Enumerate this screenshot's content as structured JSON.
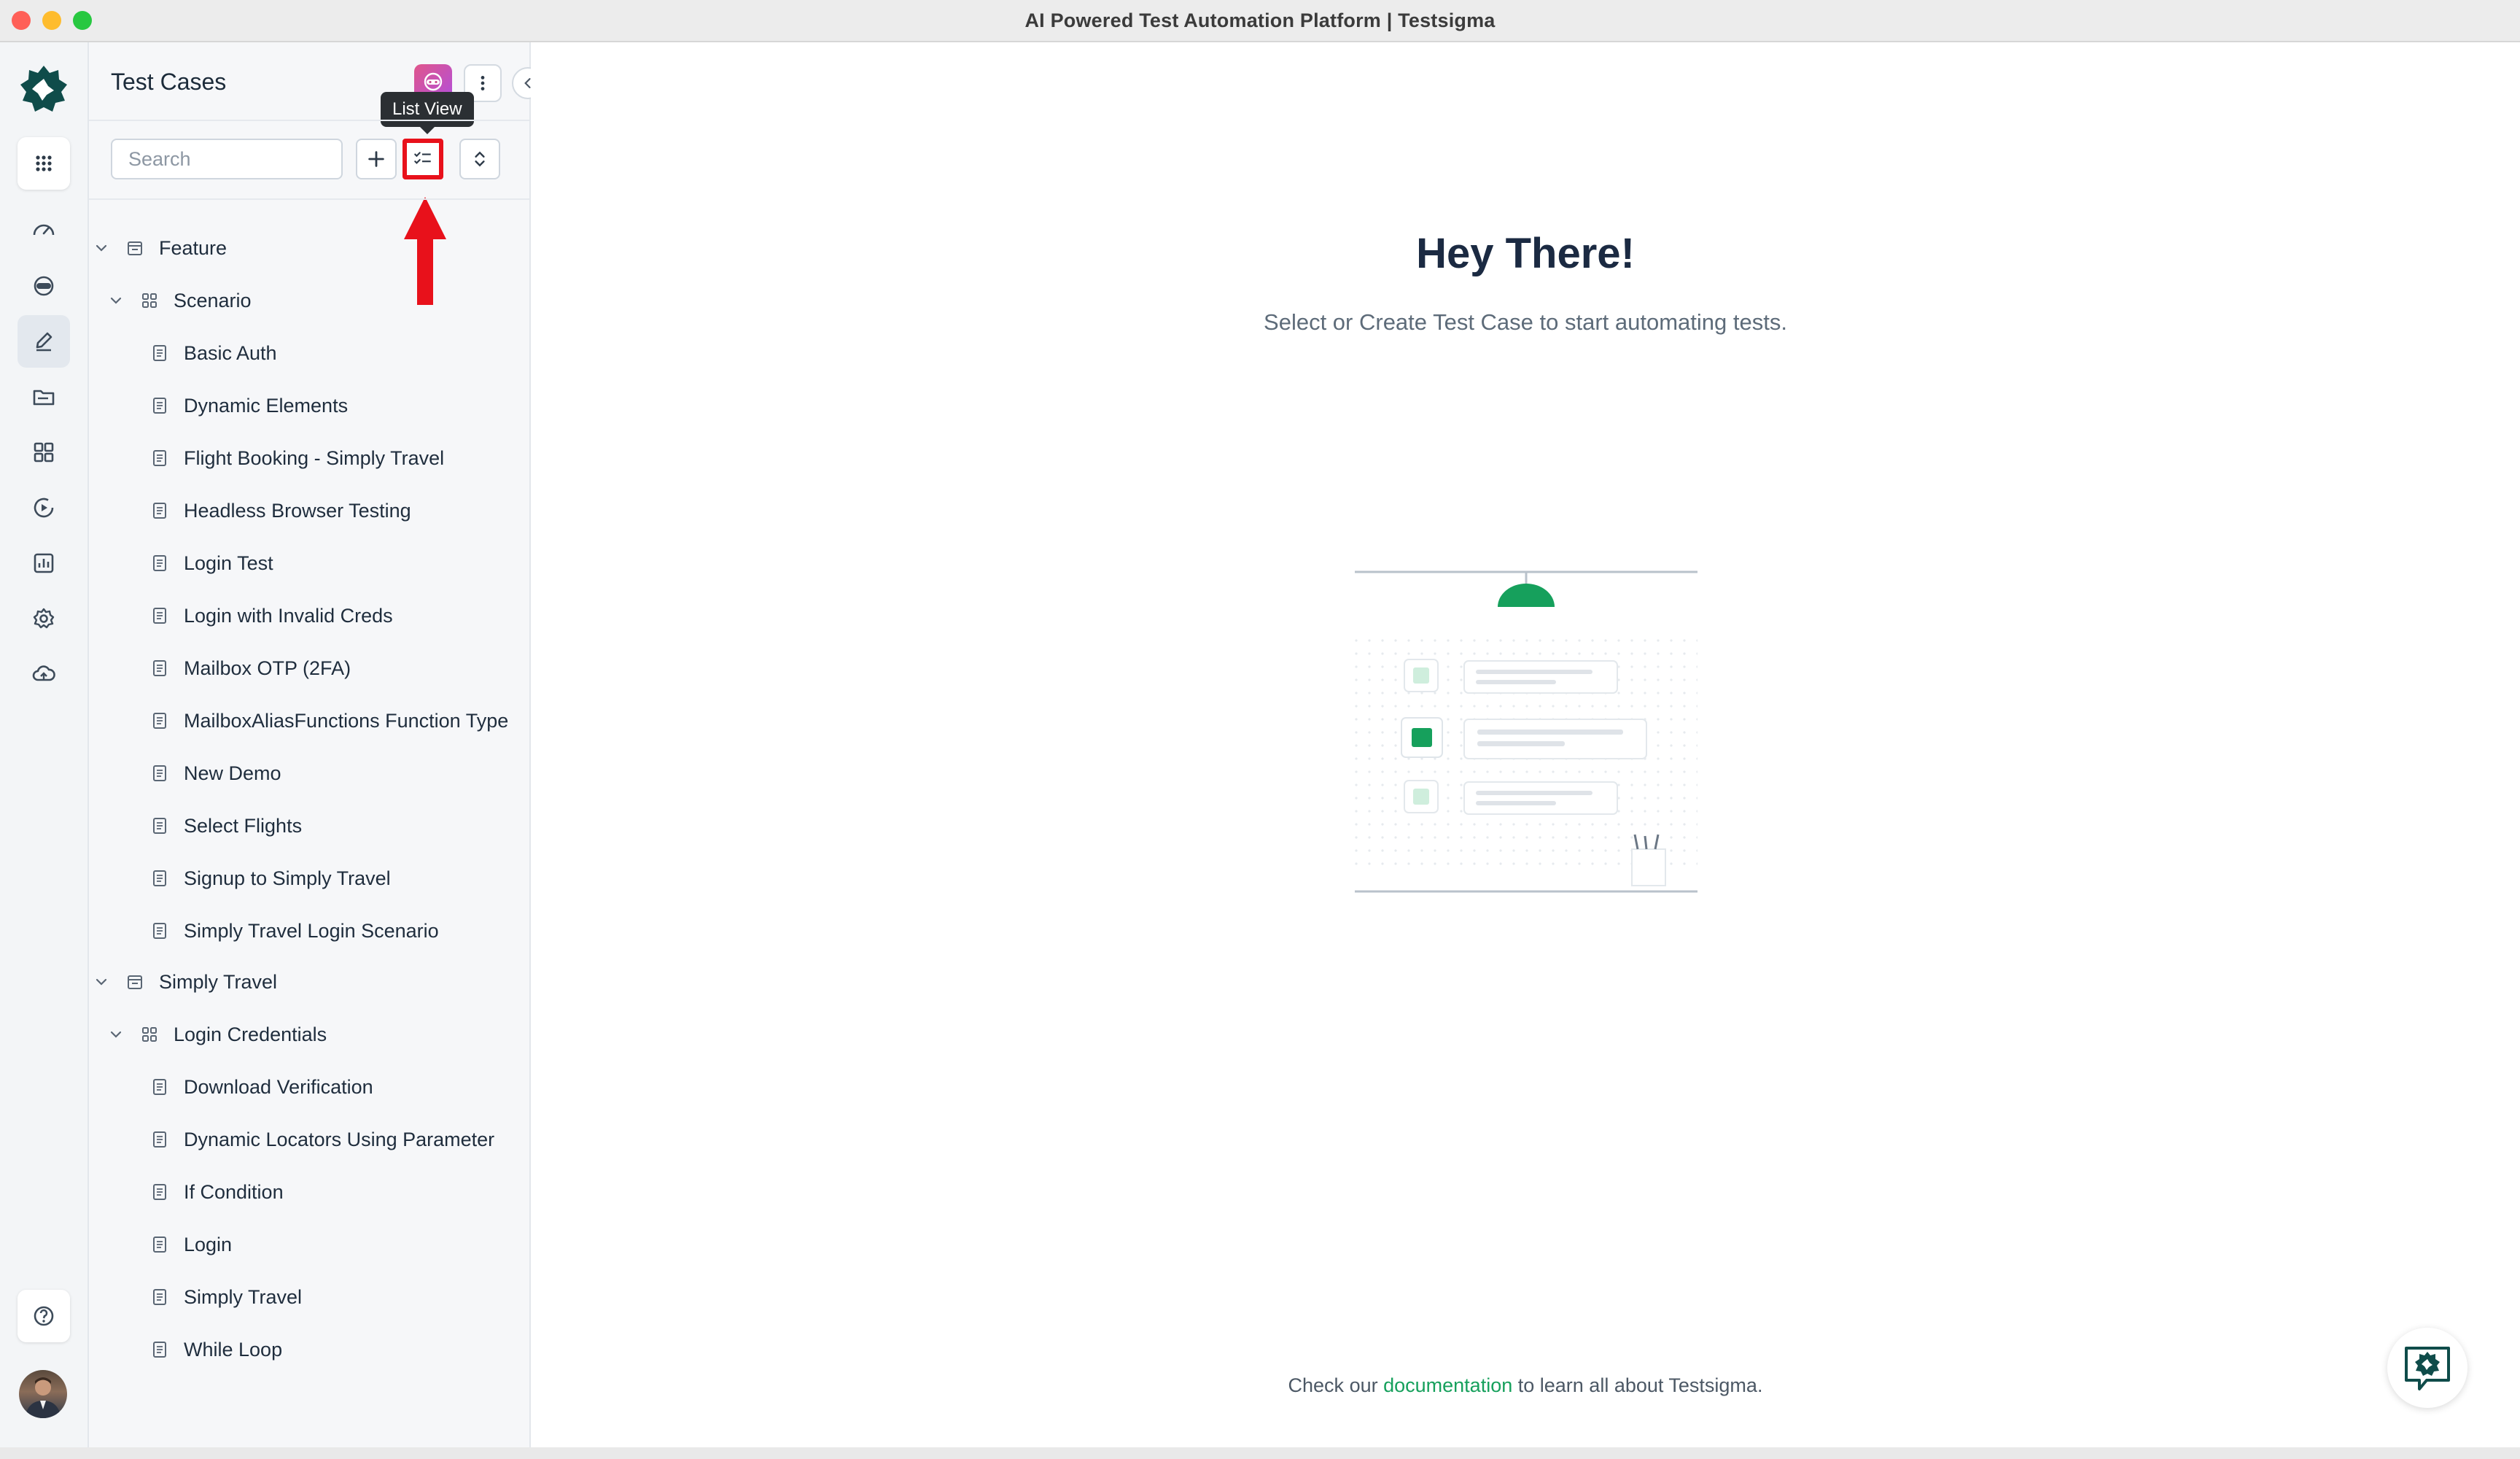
{
  "window": {
    "title": "AI Powered Test Automation Platform | Testsigma"
  },
  "nav": {
    "items": [
      {
        "icon": "apps-grid-icon"
      },
      {
        "icon": "dashboard-icon"
      },
      {
        "icon": "ai-agent-icon"
      },
      {
        "icon": "edit-test-icon"
      },
      {
        "icon": "folder-icon"
      },
      {
        "icon": "modules-icon"
      },
      {
        "icon": "run-icon"
      },
      {
        "icon": "reports-icon"
      },
      {
        "icon": "settings-icon"
      },
      {
        "icon": "cloud-icon"
      },
      {
        "icon": "help-icon"
      }
    ]
  },
  "panel": {
    "title": "Test Cases",
    "search_placeholder": "Search",
    "tooltip": "List View"
  },
  "tree": {
    "groups": [
      {
        "feature": "Feature",
        "scenario": "Scenario",
        "cases": [
          "Basic Auth",
          "Dynamic Elements",
          "Flight Booking - Simply Travel",
          "Headless Browser Testing",
          "Login Test",
          "Login with Invalid Creds",
          "Mailbox OTP (2FA)",
          "MailboxAliasFunctions Function Type",
          "New Demo",
          "Select Flights",
          "Signup to Simply Travel",
          "Simply Travel Login Scenario"
        ]
      },
      {
        "feature": "Simply Travel",
        "scenario": "Login Credentials",
        "cases": [
          "Download Verification",
          "Dynamic Locators Using Parameter",
          "If Condition",
          "Login",
          "Simply Travel",
          "While Loop"
        ]
      }
    ]
  },
  "main": {
    "heading": "Hey There!",
    "subheading": "Select or Create Test Case to start automating tests.",
    "footer_prefix": "Check our",
    "footer_link": "documentation",
    "footer_suffix": "to learn all about Testsigma."
  },
  "colors": {
    "accent": "#16a05c",
    "brand_dark": "#0f4c4a",
    "highlight": "#e8111b"
  }
}
